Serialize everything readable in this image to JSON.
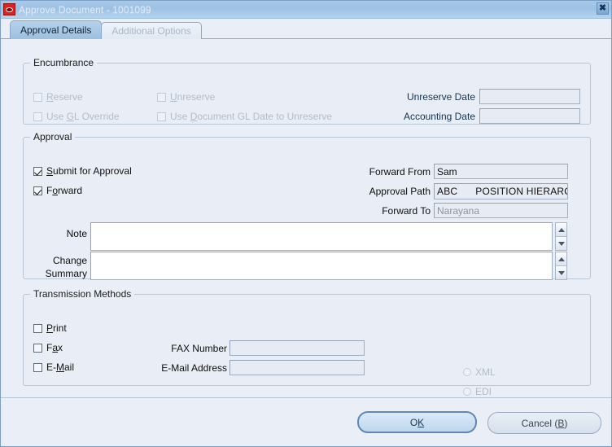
{
  "window": {
    "title": "Approve Document - 1001099",
    "app_icon": "oracle-icon",
    "close_label": "✖"
  },
  "tabs": [
    {
      "label": "Approval Details",
      "active": true
    },
    {
      "label": "Additional Options",
      "active": false
    }
  ],
  "encumbrance": {
    "legend": "Encumbrance",
    "checkboxes": [
      {
        "label_pre": "",
        "mnemonic": "R",
        "label_post": "eserve",
        "checked": false,
        "enabled": false
      },
      {
        "label_pre": "",
        "mnemonic": "U",
        "label_post": "nreserve",
        "checked": false,
        "enabled": false
      },
      {
        "label_pre": "Use ",
        "mnemonic": "G",
        "label_post": "L Override",
        "checked": false,
        "enabled": false
      },
      {
        "label_pre": "Use ",
        "mnemonic": "D",
        "label_post": "ocument GL Date to Unreserve",
        "checked": false,
        "enabled": false
      }
    ],
    "unreserve_date_label": "Unreserve Date",
    "unreserve_date_value": "",
    "accounting_date_label": "Accounting Date",
    "accounting_date_value": ""
  },
  "approval": {
    "legend": "Approval",
    "submit_pre": "",
    "submit_mnemonic": "S",
    "submit_post": "ubmit for Approval",
    "submit_checked": true,
    "forward_pre": "F",
    "forward_mnemonic": "o",
    "forward_post": "rward",
    "forward_checked": true,
    "forward_from_label": "Forward From",
    "forward_from_value": "Sam",
    "approval_path_label": "Approval Path",
    "approval_path_code": "ABC",
    "approval_path_value": "POSITION HIERARC",
    "forward_to_label": "Forward To",
    "forward_to_value": "Narayana",
    "note_label": "Note",
    "note_value": "",
    "change_summary_label_line1": "Change",
    "change_summary_label_line2": "Summary",
    "change_summary_value": ""
  },
  "transmission": {
    "legend": "Transmission Methods",
    "print_pre": "",
    "print_mnemonic": "P",
    "print_post": "rint",
    "print_checked": false,
    "fax_pre": "F",
    "fax_mnemonic": "a",
    "fax_post": "x",
    "fax_checked": false,
    "email_pre": "E-",
    "email_mnemonic": "M",
    "email_post": "ail",
    "email_checked": false,
    "fax_number_label": "FAX Number",
    "fax_number_value": "",
    "email_address_label": "E-Mail Address",
    "email_address_value": "",
    "xml_label": "XML",
    "xml_selected": false,
    "edi_label": "EDI",
    "edi_selected": false
  },
  "footer": {
    "ok_pre": "O",
    "ok_mnemonic": "K",
    "ok_post": "",
    "cancel_pre": "Cancel (",
    "cancel_mnemonic": "B",
    "cancel_post": ")"
  }
}
